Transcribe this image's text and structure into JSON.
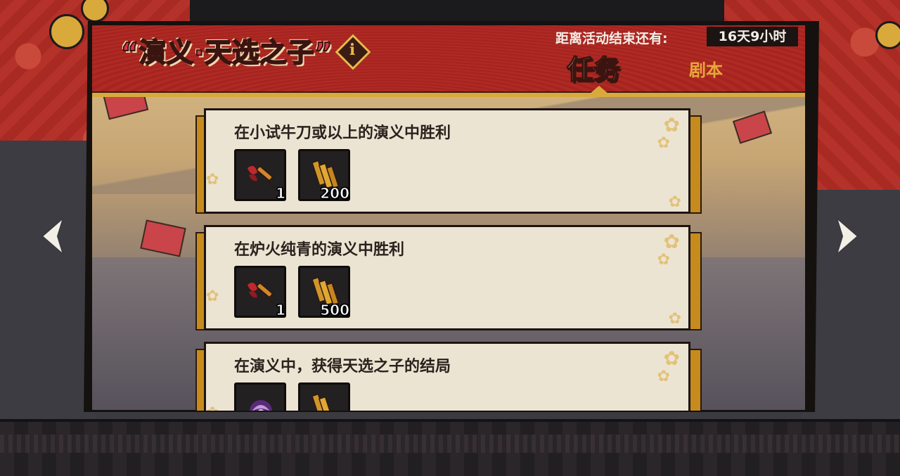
{
  "event": {
    "title": "“演义·天选之子”",
    "info_icon_char": "i",
    "timer_label": "距离活动结束还有:",
    "timer_value": "16天9小时"
  },
  "tabs": [
    {
      "label": "任务",
      "active": true
    },
    {
      "label": "剧本",
      "active": false
    }
  ],
  "tasks": [
    {
      "description": "在小试牛刀或以上的演义中胜利",
      "rewards": [
        {
          "icon": "brush-icon",
          "quantity": "1"
        },
        {
          "icon": "bamboo-slip-icon",
          "quantity": "200"
        }
      ]
    },
    {
      "description": "在炉火纯青的演义中胜利",
      "rewards": [
        {
          "icon": "brush-icon",
          "quantity": "1"
        },
        {
          "icon": "bamboo-slip-icon",
          "quantity": "500"
        }
      ]
    },
    {
      "description": "在演义中，获得天选之子的结局",
      "rewards": [
        {
          "icon": "purple-swirl-avatar-icon",
          "quantity": ""
        },
        {
          "icon": "bamboo-slip-icon",
          "quantity": ""
        }
      ]
    }
  ],
  "navigation": {
    "prev_icon": "chevron-left-icon",
    "next_icon": "chevron-right-icon"
  },
  "colors": {
    "header_red": "#a5241f",
    "gold": "#d9a93b",
    "card_bg": "#ece4d3",
    "title_red": "#e2324a"
  }
}
